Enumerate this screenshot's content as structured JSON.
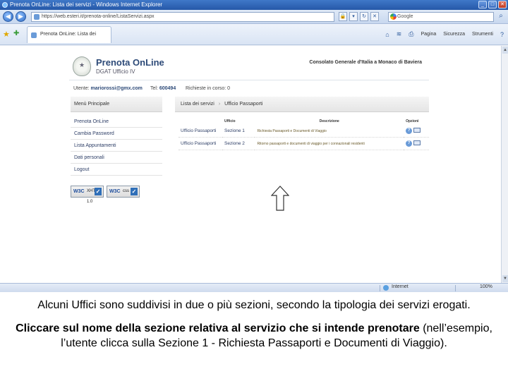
{
  "browser": {
    "window_title": "Prenota OnLine: Lista dei servizi - Windows Internet Explorer",
    "address": "https://web.esteri.it/prenota-online/ListaServizi.aspx",
    "search_engine": "Google",
    "tab_title": "Prenota OnLine: Lista dei servizi",
    "commands": {
      "page": "Pagina",
      "security": "Sicurezza",
      "tools": "Strumenti"
    },
    "status": {
      "zone": "Internet",
      "zoom": "100%"
    }
  },
  "site": {
    "brand_title": "Prenota OnLine",
    "brand_sub": "DGAT Ufficio IV",
    "consulate": "Consolato Generale d'Italia a Monaco di Baviera",
    "user_label": "Utente:",
    "user_email": "mariorossi@gmx.com",
    "tel_label": "Tel:",
    "tel_value": "600494",
    "requests_label": "Richieste in corso: 0",
    "menu_title": "Menù Principale",
    "menu": [
      "Prenota OnLine",
      "Cambia Password",
      "Lista Appuntamenti",
      "Dati personali",
      "Logout"
    ],
    "badges": {
      "xhtml": "XHTML 1.0",
      "css": "css",
      "w3c": "W3C"
    },
    "breadcrumb": {
      "first": "Lista dei servizi",
      "second": "Ufficio Passaporti"
    },
    "table": {
      "headers": [
        "Ufficio",
        "Descrizione",
        "Opzioni"
      ],
      "rows": [
        {
          "office": "Ufficio Passaporti",
          "section": "Sezione 1",
          "description": "Richiesta Passaporti e Documenti di Viaggio"
        },
        {
          "office": "Ufficio Passaporti",
          "section": "Sezione 2",
          "description": "Ritorno passaporti e documenti di viaggio per i connazionali residenti"
        }
      ]
    }
  },
  "caption": {
    "line1": "Alcuni Uffici sono suddivisi in due o più sezioni, secondo la tipologia dei servizi erogati.",
    "line2_bold": "Cliccare sul nome della sezione relativa al servizio che si intende prenotare",
    "line2_rest": "(nell’esempio, l’utente clicca sulla Sezione 1 - Richiesta Passaporti e Documenti di Viaggio)."
  }
}
